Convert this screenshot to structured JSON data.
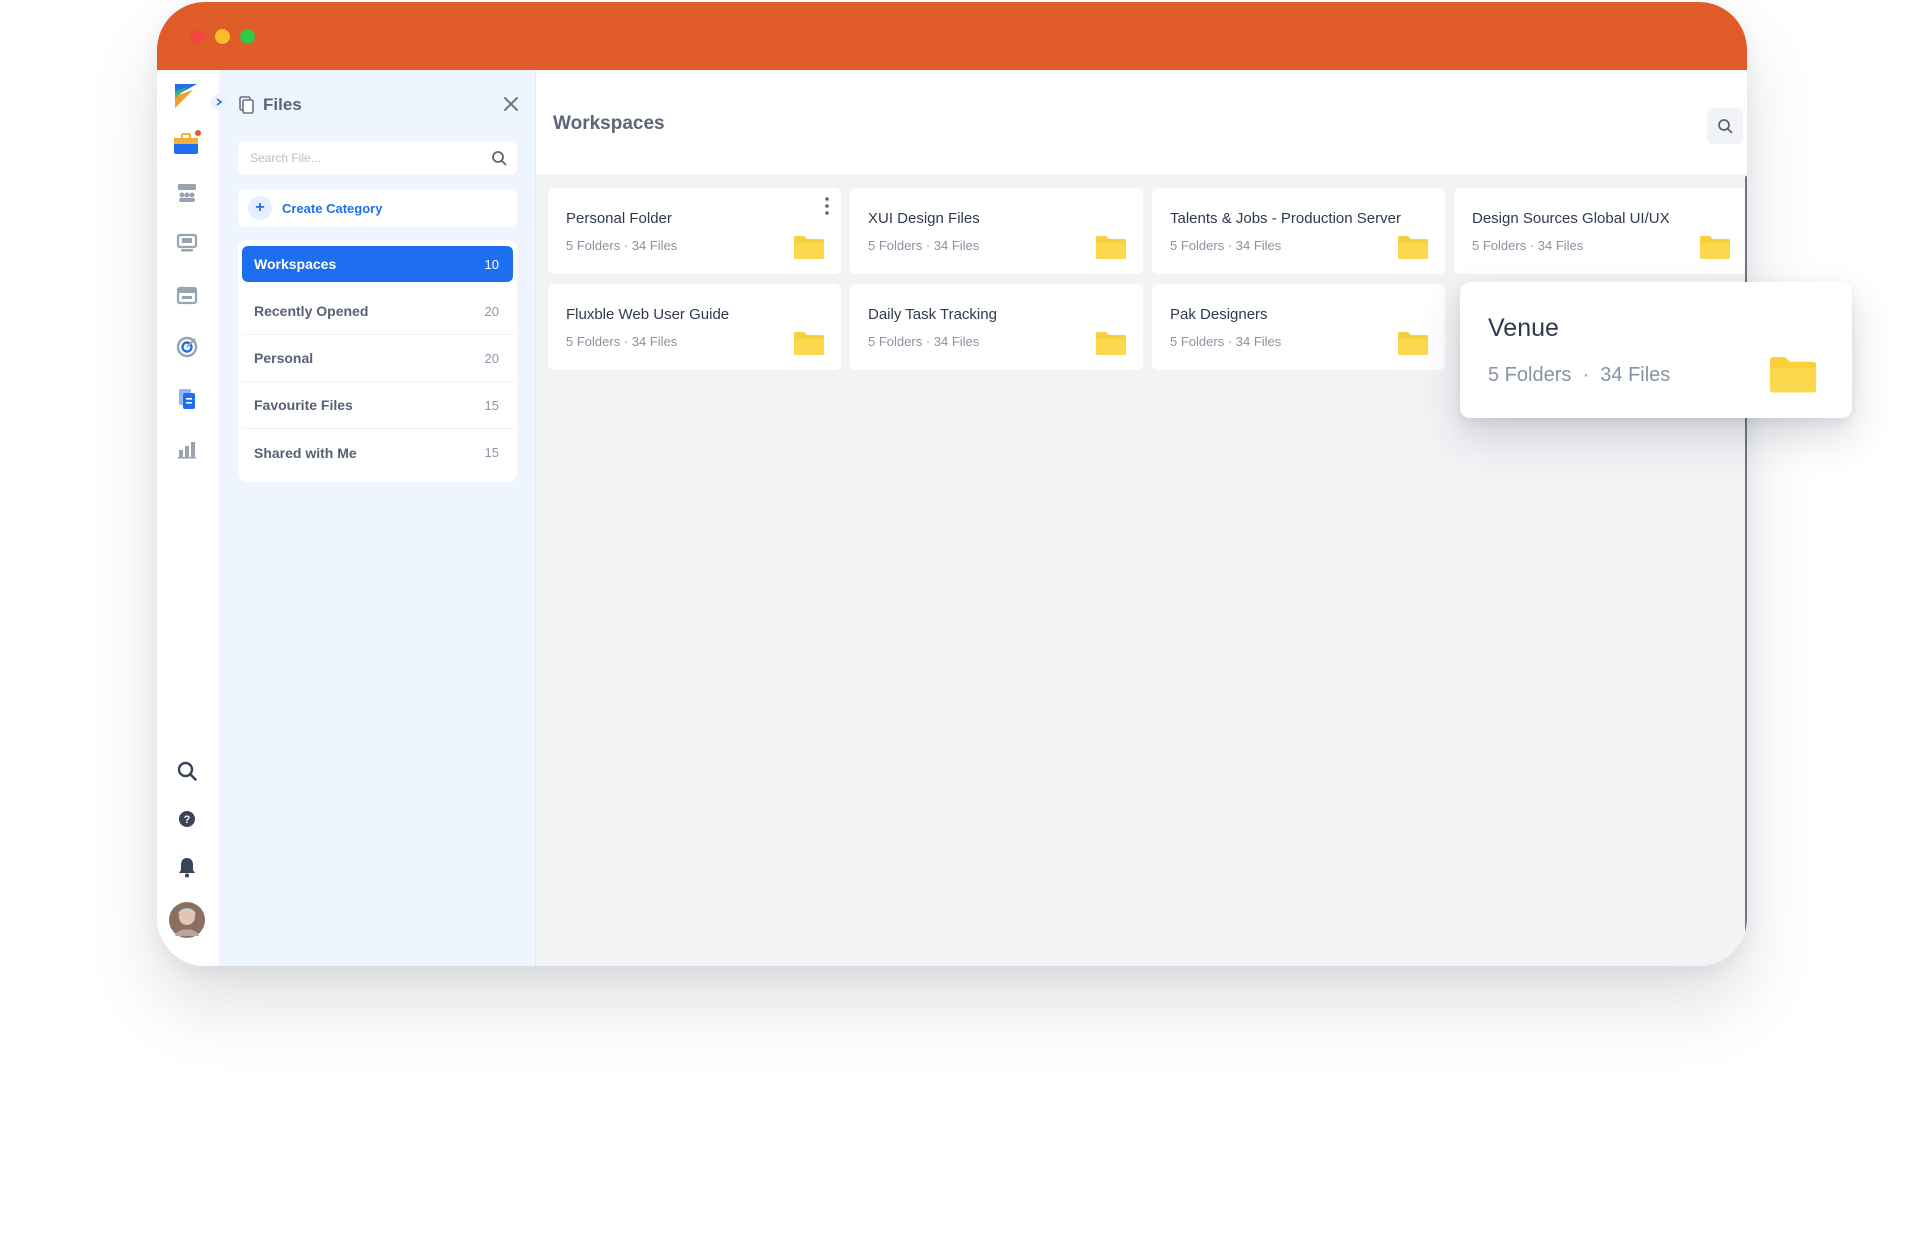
{
  "app": {
    "accent_color": "#1e6ff0",
    "titlebar_color": "#e05d2a",
    "folder_color": "#f9cf3c"
  },
  "rail": {
    "icons": [
      "logo-icon",
      "briefcase-icon",
      "team-icon",
      "monitor-icon",
      "calendar-icon",
      "target-icon",
      "files-icon",
      "chart-icon",
      "search-icon",
      "help-icon",
      "bell-icon",
      "avatar"
    ]
  },
  "sidebar": {
    "title": "Files",
    "search_placeholder": "Search File...",
    "create_category_label": "Create Category",
    "items": [
      {
        "label": "Workspaces",
        "count": "10",
        "active": true
      },
      {
        "label": "Recently Opened",
        "count": "20"
      },
      {
        "label": "Personal",
        "count": "20"
      },
      {
        "label": "Favourite Files",
        "count": "15"
      },
      {
        "label": "Shared with Me",
        "count": "15"
      }
    ]
  },
  "main": {
    "title": "Workspaces",
    "cards": [
      {
        "title": "Personal Folder",
        "folders": "5 Folders",
        "files": "34 Files"
      },
      {
        "title": "XUI Design Files",
        "folders": "5 Folders",
        "files": "34 Files"
      },
      {
        "title": "Talents & Jobs - Production Server",
        "folders": "5 Folders",
        "files": "34 Files"
      },
      {
        "title": "Design Sources Global UI/UX",
        "folders": "5 Folders",
        "files": "34 Files"
      },
      {
        "title": "Fluxble Web User Guide",
        "folders": "5 Folders",
        "files": "34 Files"
      },
      {
        "title": "Daily Task Tracking",
        "folders": "5 Folders",
        "files": "34 Files"
      },
      {
        "title": "Pak Designers",
        "folders": "5 Folders",
        "files": "34 Files"
      },
      {
        "title": "Venue",
        "folders": "5 Folders",
        "files": "34 Files"
      }
    ]
  }
}
